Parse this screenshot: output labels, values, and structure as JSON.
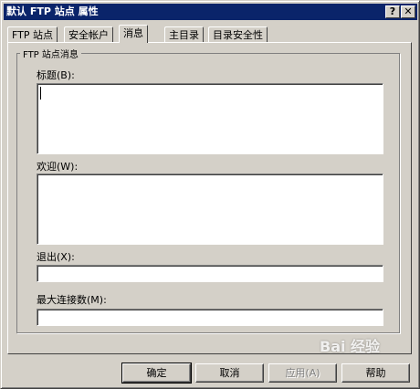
{
  "window": {
    "title": "默认 FTP 站点 属性",
    "help_glyph": "?",
    "close_glyph": "✕"
  },
  "tabs": [
    {
      "label": "FTP 站点",
      "active": false
    },
    {
      "label": "安全帐户",
      "active": false
    },
    {
      "label": "消息",
      "active": true
    },
    {
      "label": "主目录",
      "active": false
    },
    {
      "label": "目录安全性",
      "active": false
    }
  ],
  "group": {
    "label": "FTP 站点消息",
    "fields": {
      "banner": {
        "label": "标题(B):",
        "value": ""
      },
      "welcome": {
        "label": "欢迎(W):",
        "value": ""
      },
      "exit": {
        "label": "退出(X):",
        "value": ""
      },
      "max_connections": {
        "label": "最大连接数(M):",
        "value": ""
      }
    }
  },
  "buttons": {
    "ok": "确定",
    "cancel": "取消",
    "apply": "应用(A)",
    "help": "帮助"
  },
  "watermark": "Bai 经验",
  "colors": {
    "titlebar": "#0a246a",
    "face": "#d4d0c8"
  }
}
